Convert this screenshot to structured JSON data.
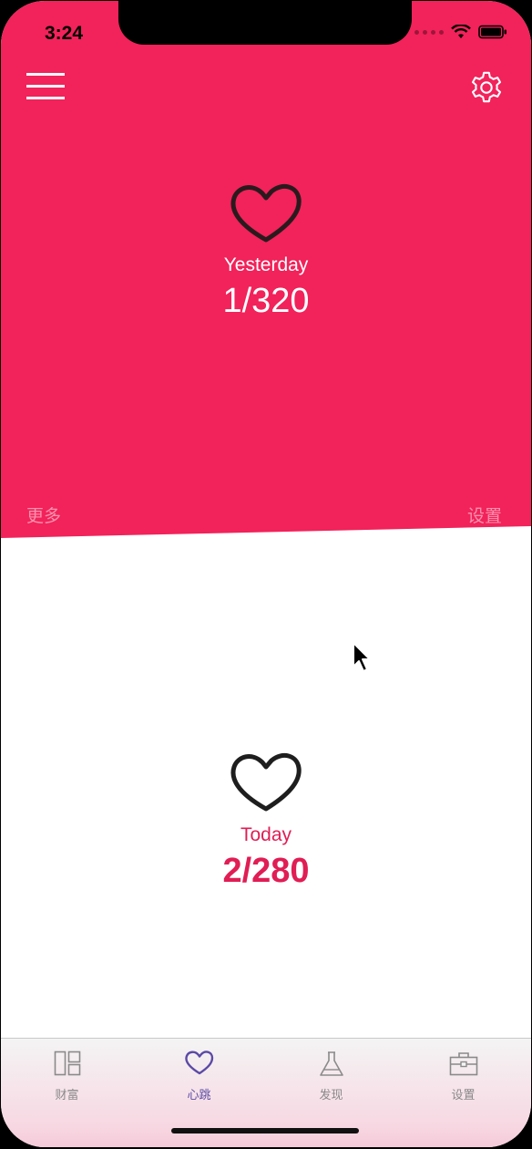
{
  "status_bar": {
    "time": "3:24"
  },
  "top_panel": {
    "label": "Yesterday",
    "value": "1/320",
    "more_link": "更多",
    "settings_link": "设置"
  },
  "bottom_panel": {
    "label": "Today",
    "value": "2/280"
  },
  "tab_bar": {
    "items": [
      {
        "label": "财富",
        "icon": "layout-grid-icon"
      },
      {
        "label": "心跳",
        "icon": "heart-icon",
        "active": true
      },
      {
        "label": "发现",
        "icon": "flask-icon"
      },
      {
        "label": "设置",
        "icon": "briefcase-icon"
      }
    ]
  },
  "colors": {
    "accent": "#f2225a",
    "today_text": "#e01d54",
    "active_tab": "#5b4aa5"
  }
}
